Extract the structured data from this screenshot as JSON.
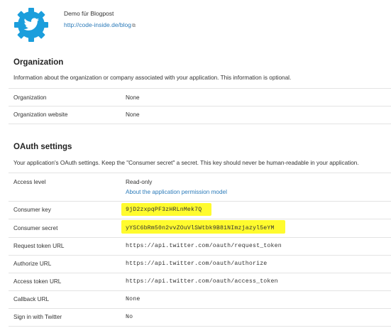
{
  "app": {
    "description": "Demo für Blogpost",
    "url": "http://code-inside.de/blog",
    "external_link_icon": "⧉",
    "logo_icon": "twitter-gear-logo",
    "logo_color": "#1b9edc"
  },
  "organization": {
    "title": "Organization",
    "description": "Information about the organization or company associated with your application. This information is optional.",
    "rows": [
      {
        "label": "Organization",
        "value": "None"
      },
      {
        "label": "Organization website",
        "value": "None"
      }
    ]
  },
  "oauth": {
    "title": "OAuth settings",
    "description": "Your application's OAuth settings. Keep the \"Consumer secret\" a secret. This key should never be human-readable in your application.",
    "access_level": {
      "label": "Access level",
      "value": "Read-only",
      "link": "About the application permission model"
    },
    "consumer_key": {
      "label": "Consumer key",
      "value": "9jD2zxpqPF3zHRLnMek7Q"
    },
    "consumer_secret": {
      "label": "Consumer secret",
      "value": "yYSC6bRm50n2vvZOuVlSWtbk9B81NImzjazyl5eYM"
    },
    "request_token_url": {
      "label": "Request token URL",
      "value": "https://api.twitter.com/oauth/request_token"
    },
    "authorize_url": {
      "label": "Authorize URL",
      "value": "https://api.twitter.com/oauth/authorize"
    },
    "access_token_url": {
      "label": "Access token URL",
      "value": "https://api.twitter.com/oauth/access_token"
    },
    "callback_url": {
      "label": "Callback URL",
      "value": "None"
    },
    "sign_in": {
      "label": "Sign in with Twitter",
      "value": "No"
    }
  },
  "colors": {
    "highlight": "#fffb2e",
    "link": "#2a7ab9"
  }
}
